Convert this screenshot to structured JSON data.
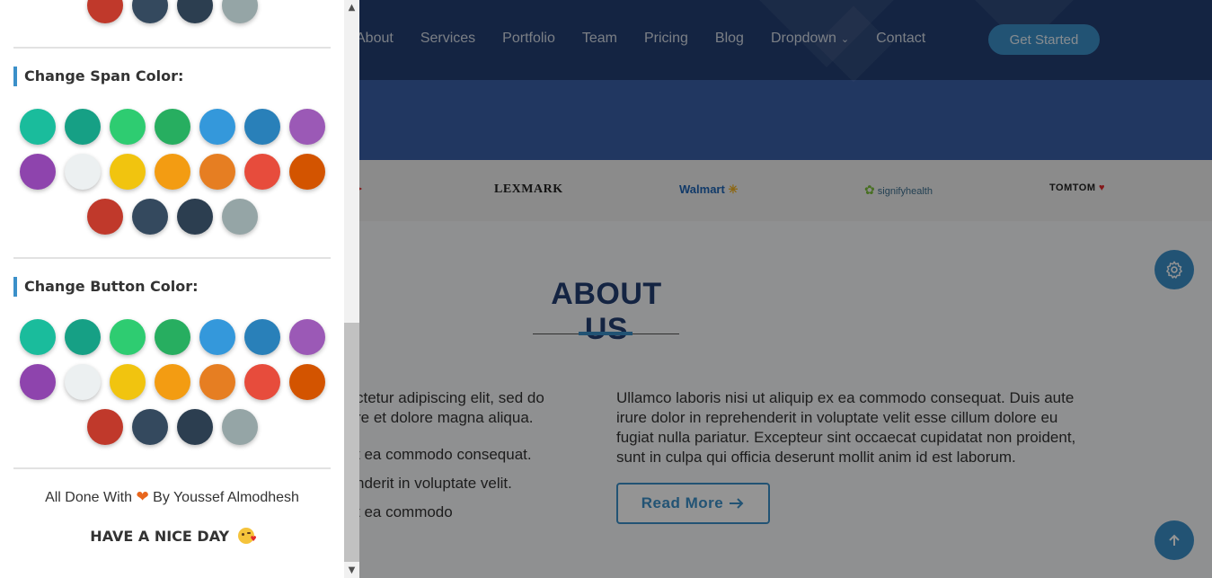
{
  "nav": {
    "items": [
      "About",
      "Services",
      "Portfolio",
      "Team",
      "Pricing",
      "Blog",
      "Dropdown",
      "Contact"
    ],
    "cta": "Get Started"
  },
  "clients": {
    "lexmark": "LEXMARK",
    "walmart": "Walmart",
    "signify": "signifyhealth",
    "tomtom": "TOMTOM"
  },
  "about": {
    "title": "ABOUT US",
    "left_lines": [
      "ctetur adipiscing elit, sed do",
      "re et dolore magna aliqua.",
      "t ea commodo consequat.",
      "nderit in voluptate velit.",
      "t ea commodo"
    ],
    "right_paragraph": "Ullamco laboris nisi ut aliquip ex ea commodo consequat. Duis aute irure dolor in reprehenderit in voluptate velit esse cillum dolore eu fugiat nulla pariatur. Excepteur sint occaecat cupidatat non proident, sunt in culpa qui officia deserunt mollit anim id est laborum.",
    "read_more": "Read More"
  },
  "panel": {
    "top_colors": [
      "#c0392b",
      "#34495e",
      "#2c3e50",
      "#95a5a6"
    ],
    "sections": [
      {
        "title": "Change Span Color:"
      },
      {
        "title": "Change Button Color:"
      }
    ],
    "palette": [
      "#1abc9c",
      "#16a085",
      "#2ecc71",
      "#27ae60",
      "#3498db",
      "#2980b9",
      "#9b59b6",
      "#8e44ad",
      "#ecf0f1",
      "#f1c40f",
      "#f39c12",
      "#e67e22",
      "#e74c3c",
      "#d35400",
      "#c0392b",
      "#34495e",
      "#2c3e50",
      "#95a5a6"
    ],
    "footer_before": "All Done With",
    "footer_after": "By Youssef Almodhesh",
    "footer_nice": "HAVE A NICE DAY"
  },
  "icons": {
    "settings": "gear-icon",
    "scroll_top": "arrow-up-icon",
    "love": "heart-icon",
    "wink": "kissing-face-icon",
    "dropdown": "chevron-down-icon"
  },
  "colors": {
    "accent": "#3b90c9",
    "header_bg": "#233f73",
    "heading": "#233f73"
  }
}
